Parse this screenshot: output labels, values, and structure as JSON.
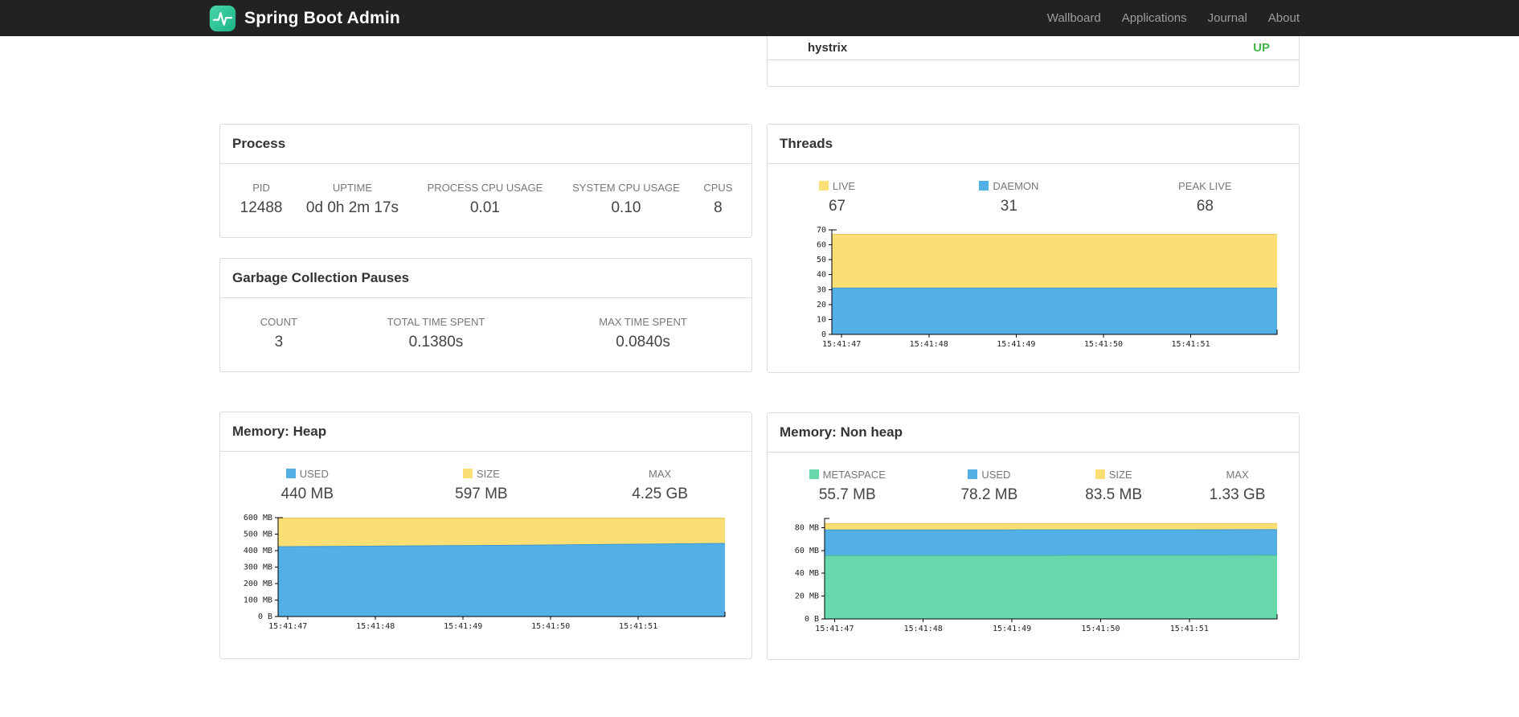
{
  "navbar": {
    "brand": "Spring Boot Admin",
    "links": [
      {
        "label": "Wallboard"
      },
      {
        "label": "Applications"
      },
      {
        "label": "Journal"
      },
      {
        "label": "About"
      }
    ]
  },
  "application": {
    "name": "hystrix",
    "status": "UP",
    "status_color": "#42b649"
  },
  "process": {
    "title": "Process",
    "stats": [
      {
        "label": "PID",
        "value": "12488"
      },
      {
        "label": "UPTIME",
        "value": "0d 0h 2m 17s"
      },
      {
        "label": "PROCESS CPU USAGE",
        "value": "0.01"
      },
      {
        "label": "SYSTEM CPU USAGE",
        "value": "0.10"
      },
      {
        "label": "CPUS",
        "value": "8"
      }
    ]
  },
  "gc": {
    "title": "Garbage Collection Pauses",
    "stats": [
      {
        "label": "COUNT",
        "value": "3"
      },
      {
        "label": "TOTAL TIME SPENT",
        "value": "0.1380s"
      },
      {
        "label": "MAX TIME SPENT",
        "value": "0.0840s"
      }
    ]
  },
  "threads": {
    "title": "Threads",
    "stats": [
      {
        "label": "LIVE",
        "value": "67",
        "swatch": "#fbde74"
      },
      {
        "label": "DAEMON",
        "value": "31",
        "swatch": "#53b0e5"
      },
      {
        "label": "PEAK LIVE",
        "value": "68"
      }
    ]
  },
  "memory_heap": {
    "title": "Memory: Heap",
    "stats": [
      {
        "label": "USED",
        "value": "440 MB",
        "swatch": "#53b0e5"
      },
      {
        "label": "SIZE",
        "value": "597 MB",
        "swatch": "#fbde74"
      },
      {
        "label": "MAX",
        "value": "4.25 GB"
      }
    ]
  },
  "memory_nonheap": {
    "title": "Memory: Non heap",
    "stats": [
      {
        "label": "METASPACE",
        "value": "55.7 MB",
        "swatch": "#67d8ac"
      },
      {
        "label": "USED",
        "value": "78.2 MB",
        "swatch": "#53b0e5"
      },
      {
        "label": "SIZE",
        "value": "83.5 MB",
        "swatch": "#fbde74"
      },
      {
        "label": "MAX",
        "value": "1.33 GB"
      }
    ]
  },
  "chart_data": [
    {
      "id": "threads",
      "type": "area",
      "title": "Threads",
      "legend_position": "top",
      "grid": false,
      "x_labels": [
        "15:41:47",
        "15:41:48",
        "15:41:49",
        "15:41:50",
        "15:41:51"
      ],
      "ylim": [
        0,
        70
      ],
      "yticks": [
        {
          "v": 0,
          "label": "0"
        },
        {
          "v": 10,
          "label": "10"
        },
        {
          "v": 20,
          "label": "20"
        },
        {
          "v": 30,
          "label": "30"
        },
        {
          "v": 40,
          "label": "40"
        },
        {
          "v": 50,
          "label": "50"
        },
        {
          "v": 60,
          "label": "60"
        },
        {
          "v": 70,
          "label": "70"
        }
      ],
      "series": [
        {
          "name": "LIVE",
          "color": "#fbde74",
          "stroke": "#e8c44e",
          "values": [
            67,
            67,
            67,
            67,
            67,
            67
          ]
        },
        {
          "name": "DAEMON",
          "color": "#53b0e5",
          "stroke": "#3d97cf",
          "values": [
            31,
            31,
            31,
            31,
            31,
            31
          ]
        }
      ]
    },
    {
      "id": "memory-heap",
      "type": "area",
      "title": "Memory: Heap",
      "legend_position": "top",
      "grid": false,
      "x_labels": [
        "15:41:47",
        "15:41:48",
        "15:41:49",
        "15:41:50",
        "15:41:51"
      ],
      "ylim": [
        0,
        600
      ],
      "yticks": [
        {
          "v": 0,
          "label": "0 B"
        },
        {
          "v": 100,
          "label": "100 MB"
        },
        {
          "v": 200,
          "label": "200 MB"
        },
        {
          "v": 300,
          "label": "300 MB"
        },
        {
          "v": 400,
          "label": "400 MB"
        },
        {
          "v": 500,
          "label": "500 MB"
        },
        {
          "v": 600,
          "label": "600 MB"
        }
      ],
      "series": [
        {
          "name": "SIZE",
          "color": "#fbde74",
          "stroke": "#e8c44e",
          "values": [
            597,
            597,
            597,
            597,
            597,
            597
          ]
        },
        {
          "name": "USED",
          "color": "#53b0e5",
          "stroke": "#3d97cf",
          "values": [
            424,
            427,
            430,
            434,
            439,
            444
          ]
        }
      ]
    },
    {
      "id": "memory-nonheap",
      "type": "area",
      "title": "Memory: Non heap",
      "legend_position": "top",
      "grid": false,
      "x_labels": [
        "15:41:47",
        "15:41:48",
        "15:41:49",
        "15:41:50",
        "15:41:51"
      ],
      "ylim": [
        0,
        88
      ],
      "yticks": [
        {
          "v": 0,
          "label": "0 B"
        },
        {
          "v": 20,
          "label": "20 MB"
        },
        {
          "v": 40,
          "label": "40 MB"
        },
        {
          "v": 60,
          "label": "60 MB"
        },
        {
          "v": 80,
          "label": "80 MB"
        }
      ],
      "series": [
        {
          "name": "SIZE",
          "color": "#fbde74",
          "stroke": "#e8c44e",
          "values": [
            83.5,
            83.5,
            83.5,
            83.5,
            83.5,
            83.5
          ]
        },
        {
          "name": "USED",
          "color": "#53b0e5",
          "stroke": "#3d97cf",
          "values": [
            77.9,
            78.0,
            78.0,
            78.1,
            78.1,
            78.2
          ]
        },
        {
          "name": "METASPACE",
          "color": "#67d8ac",
          "stroke": "#46bd92",
          "values": [
            55.4,
            55.5,
            55.5,
            55.6,
            55.6,
            55.7
          ]
        }
      ]
    }
  ]
}
